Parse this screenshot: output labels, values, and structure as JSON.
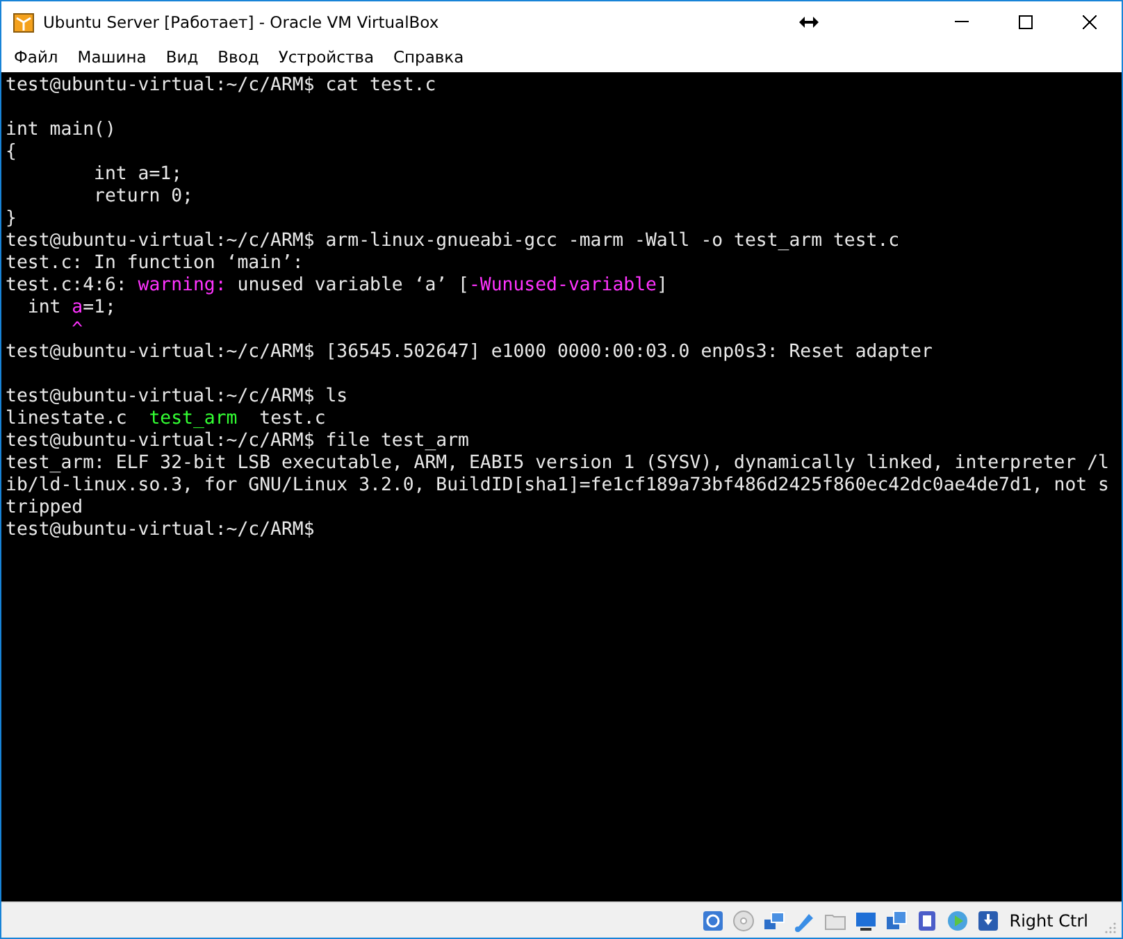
{
  "window": {
    "title": "Ubuntu Server [Работает] - Oracle VM VirtualBox"
  },
  "menu": [
    "Файл",
    "Машина",
    "Вид",
    "Ввод",
    "Устройства",
    "Справка"
  ],
  "terminal": {
    "lines": [
      {
        "kind": "text",
        "segments": [
          {
            "kind": "plain",
            "text": "test@ubuntu-virtual:~/c/ARM$ cat test.c"
          }
        ]
      },
      {
        "kind": "blank"
      },
      {
        "kind": "text",
        "segments": [
          {
            "kind": "plain",
            "text": "int main()"
          }
        ]
      },
      {
        "kind": "text",
        "segments": [
          {
            "kind": "plain",
            "text": "{"
          }
        ]
      },
      {
        "kind": "text",
        "segments": [
          {
            "kind": "plain",
            "text": "        int a=1;"
          }
        ]
      },
      {
        "kind": "text",
        "segments": [
          {
            "kind": "plain",
            "text": "        return 0;"
          }
        ]
      },
      {
        "kind": "text",
        "segments": [
          {
            "kind": "plain",
            "text": "}"
          }
        ]
      },
      {
        "kind": "text",
        "segments": [
          {
            "kind": "plain",
            "text": "test@ubuntu-virtual:~/c/ARM$ arm-linux-gnueabi-gcc -marm -Wall -o test_arm test.c"
          }
        ]
      },
      {
        "kind": "text",
        "segments": [
          {
            "kind": "plain",
            "text": "test.c: In function ‘main’:"
          }
        ]
      },
      {
        "kind": "text",
        "segments": [
          {
            "kind": "plain",
            "text": "test.c:4:6: "
          },
          {
            "kind": "warning",
            "text": "warning:"
          },
          {
            "kind": "plain",
            "text": " unused variable ‘a’ ["
          },
          {
            "kind": "warning",
            "text": "-Wunused-variable"
          },
          {
            "kind": "plain",
            "text": "]"
          }
        ]
      },
      {
        "kind": "text",
        "segments": [
          {
            "kind": "plain",
            "text": "  int "
          },
          {
            "kind": "warning",
            "text": "a"
          },
          {
            "kind": "plain",
            "text": "=1;"
          }
        ]
      },
      {
        "kind": "text",
        "segments": [
          {
            "kind": "warning",
            "text": "      ^"
          }
        ]
      },
      {
        "kind": "text",
        "segments": [
          {
            "kind": "plain",
            "text": "test@ubuntu-virtual:~/c/ARM$ [36545.502647] e1000 0000:00:03.0 enp0s3: Reset adapter"
          }
        ]
      },
      {
        "kind": "blank"
      },
      {
        "kind": "text",
        "segments": [
          {
            "kind": "plain",
            "text": "test@ubuntu-virtual:~/c/ARM$ ls"
          }
        ]
      },
      {
        "kind": "text",
        "segments": [
          {
            "kind": "plain",
            "text": "linestate.c  "
          },
          {
            "kind": "executable",
            "text": "test_arm"
          },
          {
            "kind": "plain",
            "text": "  test.c"
          }
        ]
      },
      {
        "kind": "text",
        "segments": [
          {
            "kind": "plain",
            "text": "test@ubuntu-virtual:~/c/ARM$ file test_arm"
          }
        ]
      },
      {
        "kind": "text",
        "segments": [
          {
            "kind": "plain",
            "text": "test_arm: ELF 32-bit LSB executable, ARM, EABI5 version 1 (SYSV), dynamically linked, interpreter /l"
          }
        ]
      },
      {
        "kind": "text",
        "segments": [
          {
            "kind": "plain",
            "text": "ib/ld-linux.so.3, for GNU/Linux 3.2.0, BuildID[sha1]=fe1cf189a73bf486d2425f860ec42dc0ae4de7d1, not s"
          }
        ]
      },
      {
        "kind": "text",
        "segments": [
          {
            "kind": "plain",
            "text": "tripped"
          }
        ]
      },
      {
        "kind": "text",
        "segments": [
          {
            "kind": "plain",
            "text": "test@ubuntu-virtual:~/c/ARM$"
          }
        ]
      }
    ]
  },
  "status_bar": {
    "host_key": "Right Ctrl"
  }
}
